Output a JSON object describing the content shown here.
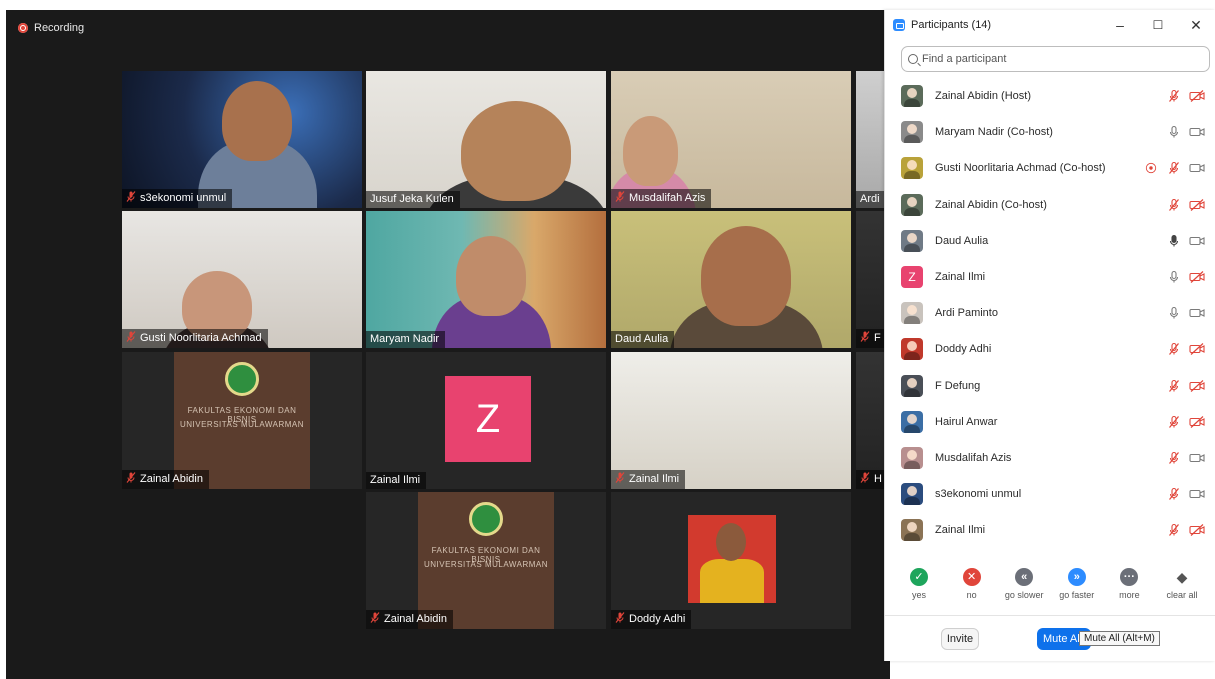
{
  "meeting": {
    "recording_label": "Recording",
    "accent_speaker_border": "#d5e64b",
    "tiles": [
      {
        "name": "s3ekonomi unmul",
        "muted": true
      },
      {
        "name": "Jusuf Jeka Kulen",
        "muted": false
      },
      {
        "name": "Musdalifah Azis",
        "muted": true
      },
      {
        "name": "Ardi",
        "muted": false
      },
      {
        "name": "Gusti Noorlitaria Achmad",
        "muted": true
      },
      {
        "name": "Maryam Nadir",
        "muted": false
      },
      {
        "name": "Daud Aulia",
        "muted": false,
        "active_speaker": true
      },
      {
        "name": "F",
        "muted": true
      },
      {
        "name": "Zainal Abidin",
        "muted": true
      },
      {
        "name": "Zainal Ilmi",
        "muted": false,
        "avatar_letter": "Z"
      },
      {
        "name": "Zainal Ilmi",
        "muted": true
      },
      {
        "name": "H",
        "muted": true
      },
      {
        "name": "Zainal Abidin",
        "muted": true
      },
      {
        "name": "Doddy Adhi",
        "muted": true
      }
    ],
    "wall_sign_lines": [
      "FAKULTAS EKONOMI DAN BISNIS",
      "UNIVERSITAS MULAWARMAN"
    ]
  },
  "panel": {
    "title": "Participants (14)",
    "minimize": "–",
    "maximize": "☐",
    "close": "✕",
    "search_placeholder": "Find a participant",
    "participants": [
      {
        "name": "Zainal Abidin (Host)",
        "mic": "off",
        "video": "off",
        "avatar_color": "#5b6b5a"
      },
      {
        "name": "Maryam Nadir (Co-host)",
        "mic": "on",
        "video": "on",
        "avatar_color": "#8a8a8a"
      },
      {
        "name": "Gusti Noorlitaria Achmad (Co-host)",
        "mic": "off",
        "video": "on",
        "recording": true,
        "avatar_color": "#b9a23a"
      },
      {
        "name": "Zainal Abidin (Co-host)",
        "mic": "off",
        "video": "off",
        "avatar_color": "#5b6b5a"
      },
      {
        "name": "Daud Aulia",
        "mic": "speaking",
        "video": "on",
        "avatar_color": "#6f7a86"
      },
      {
        "name": "Zainal Ilmi",
        "mic": "on",
        "video": "off",
        "avatar_color": "#e8436f",
        "avatar_letter": "Z"
      },
      {
        "name": "Ardi Paminto",
        "mic": "on",
        "video": "on",
        "avatar_color": "#c9c3bd"
      },
      {
        "name": "Doddy Adhi",
        "mic": "off",
        "video": "off",
        "avatar_color": "#c0392b"
      },
      {
        "name": "F Defung",
        "mic": "off",
        "video": "off",
        "avatar_color": "#4a4f57"
      },
      {
        "name": "Hairul Anwar",
        "mic": "off",
        "video": "off",
        "avatar_color": "#3b6ea5"
      },
      {
        "name": "Musdalifah Azis",
        "mic": "off",
        "video": "on",
        "avatar_color": "#b88f8f"
      },
      {
        "name": "s3ekonomi unmul",
        "mic": "off",
        "video": "on",
        "avatar_color": "#2b4c7e"
      },
      {
        "name": "Zainal Ilmi",
        "mic": "off",
        "video": "off",
        "avatar_color": "#8b7355"
      }
    ],
    "feedback": [
      {
        "label": "yes",
        "color": "#1ea55c",
        "glyph": "✓"
      },
      {
        "label": "no",
        "color": "#e0453a",
        "glyph": "✕"
      },
      {
        "label": "go slower",
        "color": "#6b6f78",
        "glyph": "«"
      },
      {
        "label": "go faster",
        "color": "#2d8cff",
        "glyph": "»"
      },
      {
        "label": "more",
        "color": "#6b6f78",
        "glyph": "···"
      },
      {
        "label": "clear all",
        "color": "#555555",
        "glyph": "◆"
      }
    ],
    "invite_label": "Invite",
    "mute_all_label": "Mute All",
    "mute_all_tooltip": "Mute All (Alt+M)"
  },
  "colors": {
    "mic_off": "#e0453a",
    "icon_gray": "#7a7a7a",
    "zoom_blue": "#0e71eb"
  }
}
